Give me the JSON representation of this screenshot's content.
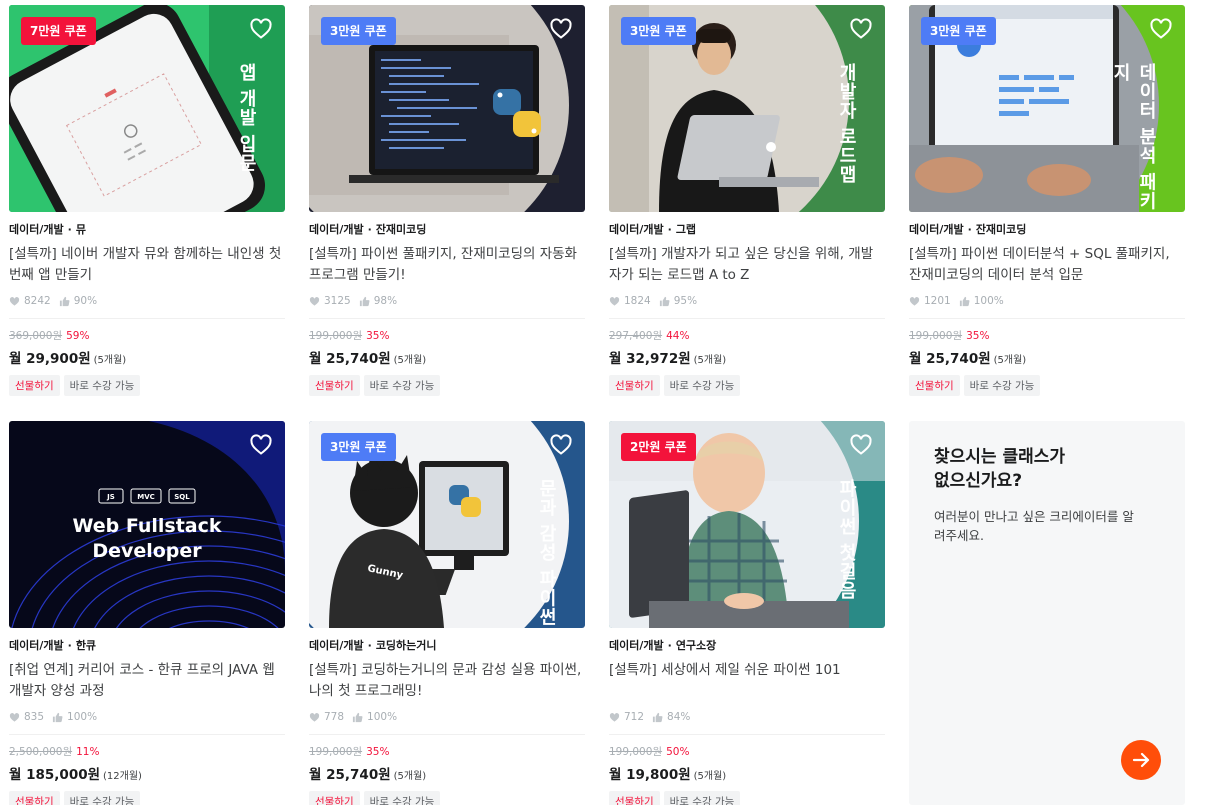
{
  "cards": [
    {
      "coupon": "7만원 쿠폰",
      "vtitle": "앱 개발 입문",
      "category": "데이터/개발",
      "creator": "뮤",
      "title": "[설특까] 네이버 개발자 뮤와 함께하는 내인생 첫번째 앱 만들기",
      "likes": "8242",
      "satisfaction": "90%",
      "original_price": "369,000원",
      "discount": "59%",
      "monthly_price": "월 29,900원",
      "months": "(5개월)"
    },
    {
      "coupon": "3만원 쿠폰",
      "vtitle": "",
      "category": "데이터/개발",
      "creator": "잔재미코딩",
      "title": "[설특까] 파이썬 풀패키지, 잔재미코딩의 자동화 프로그램 만들기!",
      "likes": "3125",
      "satisfaction": "98%",
      "original_price": "199,000원",
      "discount": "35%",
      "monthly_price": "월 25,740원",
      "months": "(5개월)"
    },
    {
      "coupon": "3만원 쿠폰",
      "vtitle": "개발자 로드맵",
      "category": "데이터/개발",
      "creator": "그랩",
      "title": "[설특까] 개발자가 되고 싶은 당신을 위해, 개발자가 되는 로드맵 A to Z",
      "likes": "1824",
      "satisfaction": "95%",
      "original_price": "297,400원",
      "discount": "44%",
      "monthly_price": "월 32,972원",
      "months": "(5개월)"
    },
    {
      "coupon": "3만원 쿠폰",
      "vtitle": "데이터 분석 패키지",
      "category": "데이터/개발",
      "creator": "잔재미코딩",
      "title": "[설특까] 파이썬 데이터분석 + SQL 풀패키지, 잔재미코딩의 데이터 분석 입문",
      "likes": "1201",
      "satisfaction": "100%",
      "original_price": "199,000원",
      "discount": "35%",
      "monthly_price": "월 25,740원",
      "months": "(5개월)"
    },
    {
      "coupon": "",
      "vtitle": "",
      "category": "데이터/개발",
      "creator": "한큐",
      "title": "[취업 연계] 커리어 코스 - 한큐 프로의 JAVA 웹 개발자 양성 과정",
      "likes": "835",
      "satisfaction": "100%",
      "original_price": "2,500,000원",
      "discount": "11%",
      "monthly_price": "월 185,000원",
      "months": "(12개월)",
      "art_tags": [
        "JS",
        "MVC",
        "SQL"
      ],
      "art_line1": "Web Fullstack",
      "art_line2": "Developer"
    },
    {
      "coupon": "3만원 쿠폰",
      "vtitle": "문과 감성 파이썬",
      "category": "데이터/개발",
      "creator": "코딩하는거니",
      "title": "[설특까] 코딩하는거니의 문과 감성 실용 파이썬, 나의 첫 프로그래밍!",
      "likes": "778",
      "satisfaction": "100%",
      "original_price": "199,000원",
      "discount": "35%",
      "monthly_price": "월 25,740원",
      "months": "(5개월)",
      "art_hoodie": "Gunny"
    },
    {
      "coupon": "2만원 쿠폰",
      "vtitle": "파이썬 첫걸음",
      "category": "데이터/개발",
      "creator": "연구소장",
      "title": "[설특까] 세상에서 제일 쉬운 파이썬 101",
      "likes": "712",
      "satisfaction": "84%",
      "original_price": "199,000원",
      "discount": "50%",
      "monthly_price": "월 19,800원",
      "months": "(5개월)"
    }
  ],
  "tags": {
    "gift": "선물하기",
    "instant": "바로 수강 가능"
  },
  "request_card": {
    "title": "찾으시는 클래스가 없으신가요?",
    "description": "여러분이 만나고 싶은 크리에이터를 알려주세요."
  },
  "colors": {
    "accent": "#ff4e0a",
    "discount": "#f3133b",
    "coupon_red": "#f3133b",
    "coupon_blue": "#4e7cf6"
  },
  "icons": {
    "heart": "heart-outline-icon",
    "like": "heart-small-icon",
    "thumb": "thumbs-up-icon",
    "arrow": "arrow-right-icon"
  }
}
